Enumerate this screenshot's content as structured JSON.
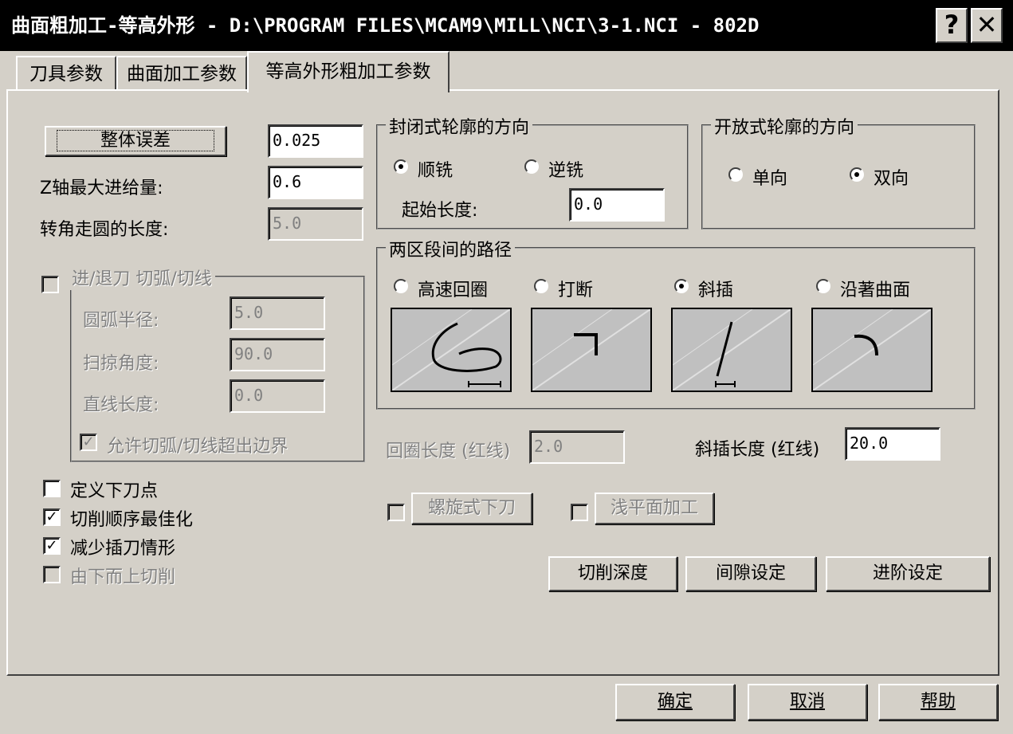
{
  "window": {
    "title": "曲面粗加工-等高外形 - D:\\PROGRAM FILES\\MCAM9\\MILL\\NCI\\3-1.NCI - 802D",
    "help_glyph": "?",
    "close_glyph": "✕"
  },
  "tabs": [
    {
      "label": "刀具参数"
    },
    {
      "label": "曲面加工参数"
    },
    {
      "label": "等高外形粗加工参数"
    }
  ],
  "left": {
    "overall_tolerance_button": "整体误差",
    "overall_tolerance_value": "0.025",
    "z_max_step_label": "Z轴最大进给量:",
    "z_max_step_value": "0.6",
    "corner_round_label": "转角走圆的长度:",
    "corner_round_value": "5.0",
    "entry_group_title": "进/退刀 切弧/切线",
    "arc_radius_label": "圆弧半径:",
    "arc_radius_value": "5.0",
    "sweep_angle_label": "扫掠角度:",
    "sweep_angle_value": "90.0",
    "line_length_label": "直线长度:",
    "line_length_value": "0.0",
    "allow_exceed_label": "允许切弧/切线超出边界",
    "define_entry_point_label": "定义下刀点",
    "optimize_order_label": "切削顺序最佳化",
    "reduce_plunge_label": "减少插刀情形",
    "bottom_up_label": "由下而上切削"
  },
  "closed_contour": {
    "title": "封闭式轮廓的方向",
    "climb_label": "顺铣",
    "conventional_label": "逆铣",
    "start_length_label": "起始长度:",
    "start_length_value": "0.0"
  },
  "open_contour": {
    "title": "开放式轮廓的方向",
    "one_way_label": "单向",
    "two_way_label": "双向"
  },
  "transition": {
    "title": "两区段间的路径",
    "options": [
      "高速回圈",
      "打断",
      "斜插",
      "沿著曲面"
    ],
    "selected_index": 2,
    "loop_length_label": "回圈长度 (红线)",
    "loop_length_value": "2.0",
    "ramp_length_label": "斜插长度 (红线)",
    "ramp_length_value": "20.0"
  },
  "buttons": {
    "helix_entry": "螺旋式下刀",
    "shallow_flat": "浅平面加工",
    "cut_depth": "切削深度",
    "gap_settings": "间隙设定",
    "advanced_settings": "进阶设定",
    "ok": "确定",
    "cancel": "取消",
    "help": "帮助"
  }
}
